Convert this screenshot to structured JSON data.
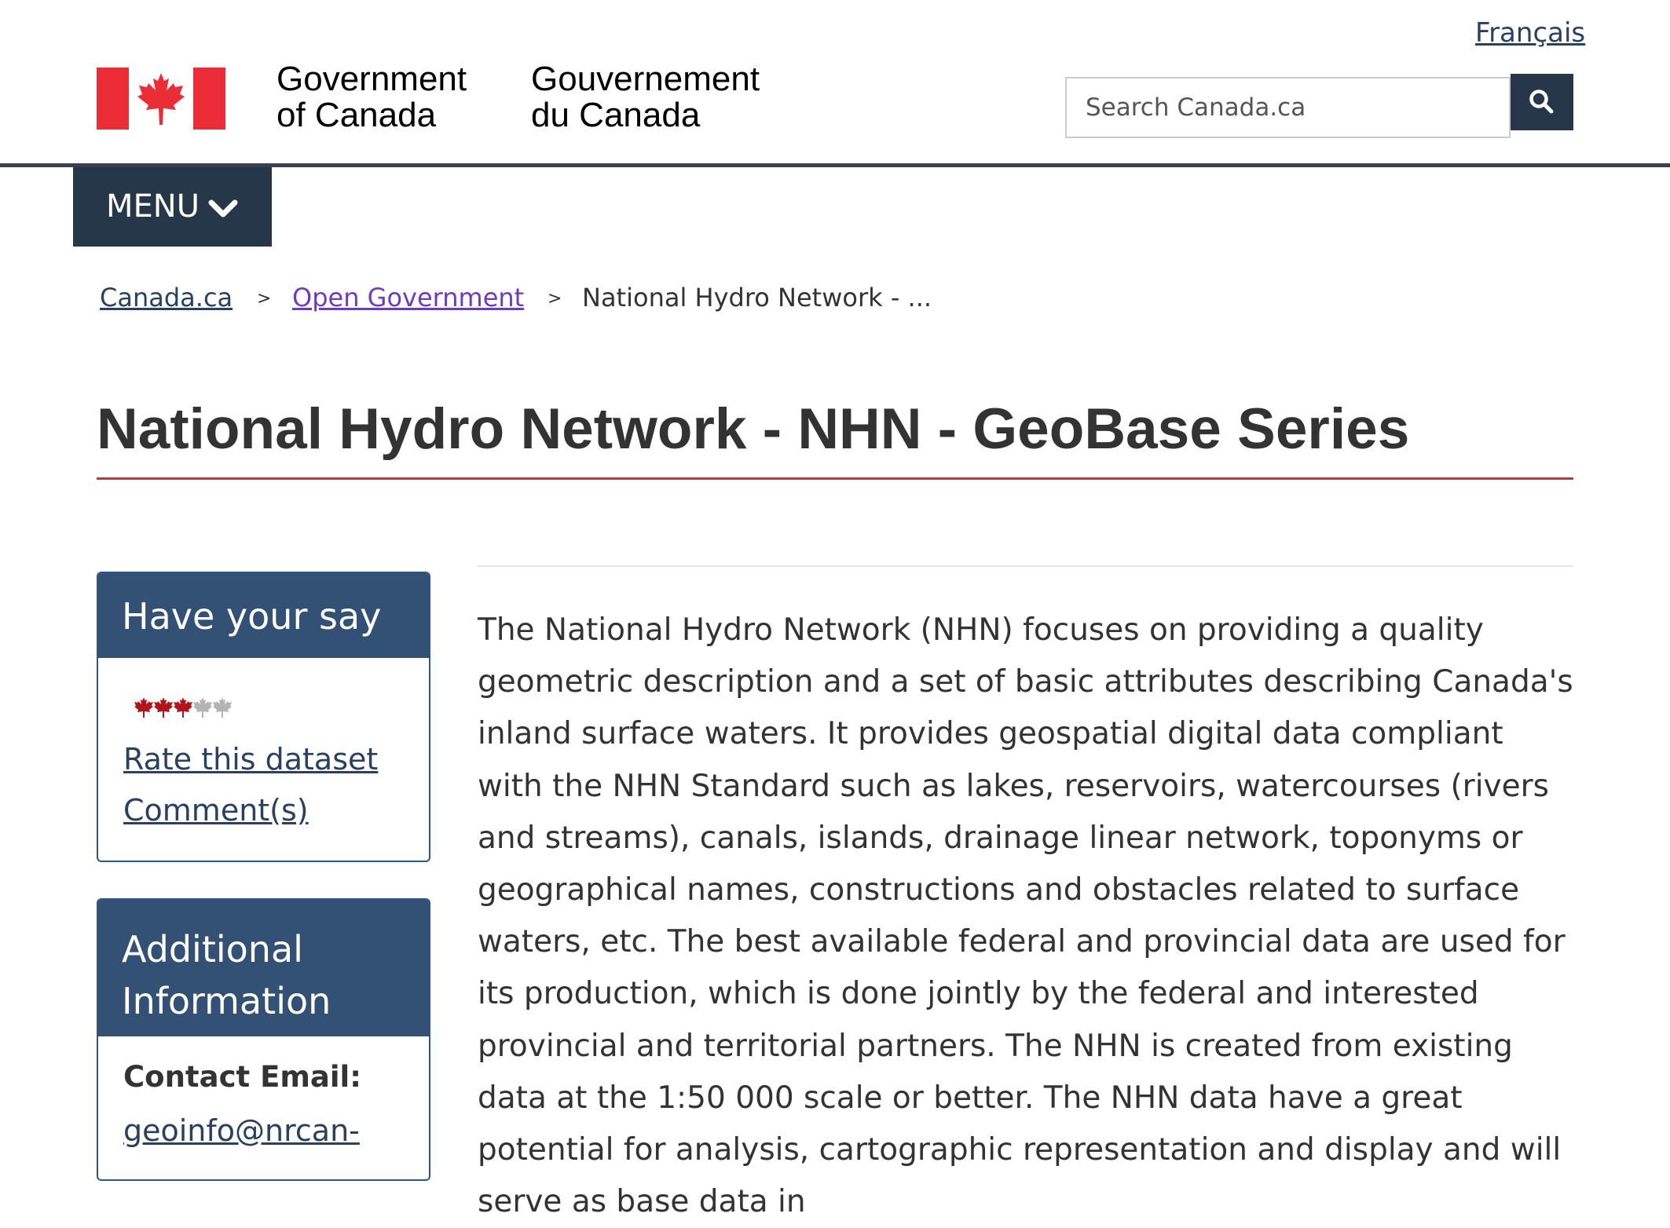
{
  "header": {
    "language_link": "Français",
    "signature_en": [
      "Government",
      "of Canada"
    ],
    "signature_fr": [
      "Gouvernement",
      "du Canada"
    ],
    "search": {
      "placeholder": "Search Canada.ca",
      "button_icon": "search-icon"
    },
    "menu": {
      "label": "MENU",
      "icon": "chevron-down-icon"
    }
  },
  "breadcrumb": {
    "items": [
      "Canada.ca",
      "Open Government",
      "National Hydro Network - ..."
    ],
    "separator": ">"
  },
  "page": {
    "title": "National Hydro Network - NHN - GeoBase Series",
    "description": "The National Hydro Network (NHN) focuses on providing a quality geometric description and a set of basic attributes describing Canada's inland surface waters. It provides geospatial digital data compliant with the NHN Standard such as lakes, reservoirs, watercourses (rivers and streams), canals, islands, drainage linear network, toponyms or geographical names, constructions and obstacles related to surface waters, etc. The best available federal and provincial data are used for its production, which is done jointly by the federal and interested provincial and territorial partners. The NHN is created from existing data at the 1:50 000 scale or better. The NHN data have a great potential for analysis, cartographic representation and display and will serve as base data in"
  },
  "sidebar": {
    "have_your_say": {
      "heading": "Have your say",
      "rating": {
        "filled": 3,
        "max": 5
      },
      "rate_link": "Rate this dataset",
      "comments_link": "Comment(s)"
    },
    "additional_info": {
      "heading": "Additional Information",
      "contact_label": "Contact Email:",
      "contact_value": "geoinfo@nrcan-"
    }
  },
  "colors": {
    "flag_red": "#eb2d37",
    "nav_dark": "#26374a",
    "panel_heading": "#335075",
    "link": "#284162",
    "visited_link": "#6f3abd",
    "title_rule": "#af3c43",
    "star_filled": "#b0151e",
    "star_empty": "#b3b3b3"
  }
}
